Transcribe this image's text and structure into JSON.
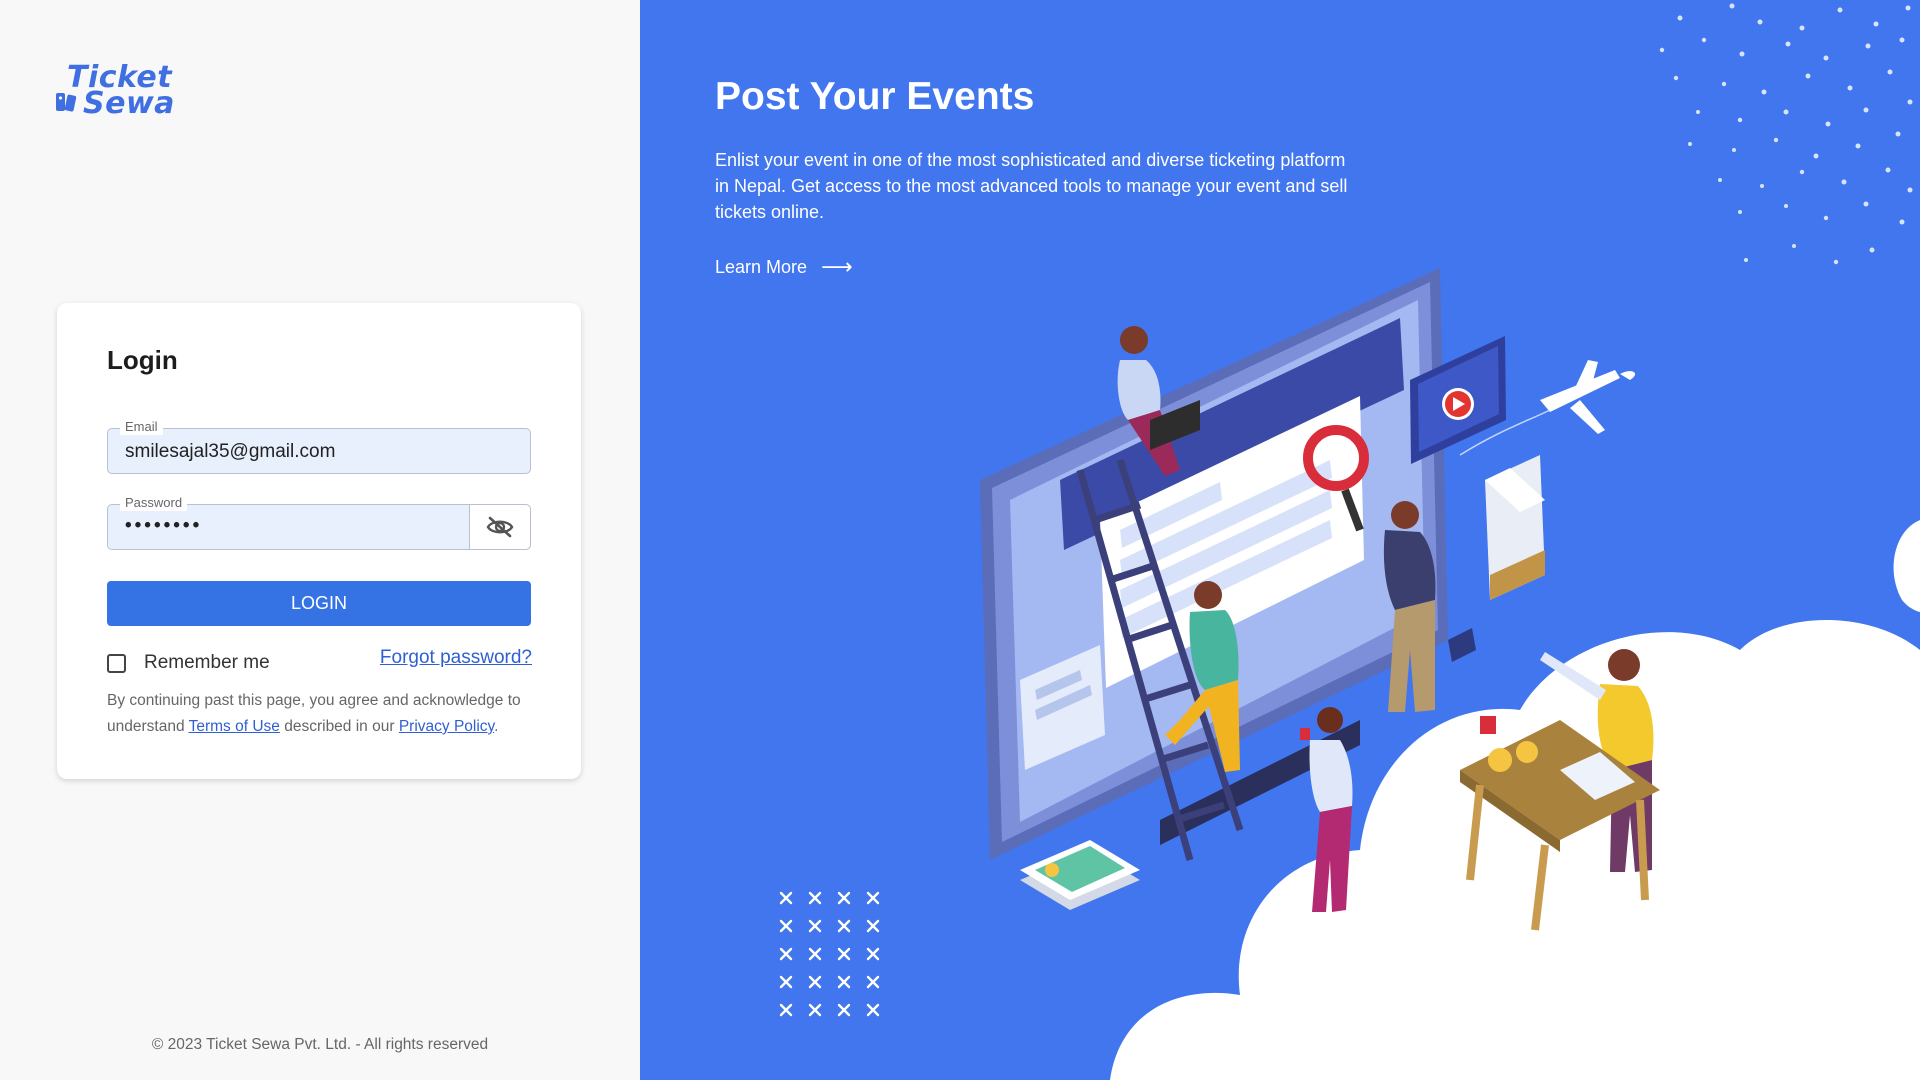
{
  "brand": {
    "logo_line1": "Ticket",
    "logo_line2": "Sewa",
    "accent_color": "#3f6fe0"
  },
  "login": {
    "title": "Login",
    "email_label": "Email",
    "email_value": "smilesajal35@gmail.com",
    "password_label": "Password",
    "password_masked": "••••••••",
    "eye_icon": "eye-off-icon",
    "login_button": "LOGIN",
    "remember_label": "Remember me",
    "forgot_link": "Forgot password?",
    "terms_prefix": "By continuing past this page, you agree and acknowledge to understand",
    "terms_link": "Terms of Use",
    "terms_middle": "described in our",
    "privacy_link": "Privacy Policy",
    "terms_suffix": "."
  },
  "footer": {
    "copyright": "© 2023 Ticket Sewa Pvt. Ltd. - All rights reserved"
  },
  "hero": {
    "title": "Post Your Events",
    "description": "Enlist your event in one of the most sophisticated and diverse ticketing platform in Nepal. Get access to the most advanced tools to manage your event and sell tickets online.",
    "learn_more": "Learn More",
    "arrow_icon": "arrow-right-icon",
    "background_color": "#4176ee"
  }
}
